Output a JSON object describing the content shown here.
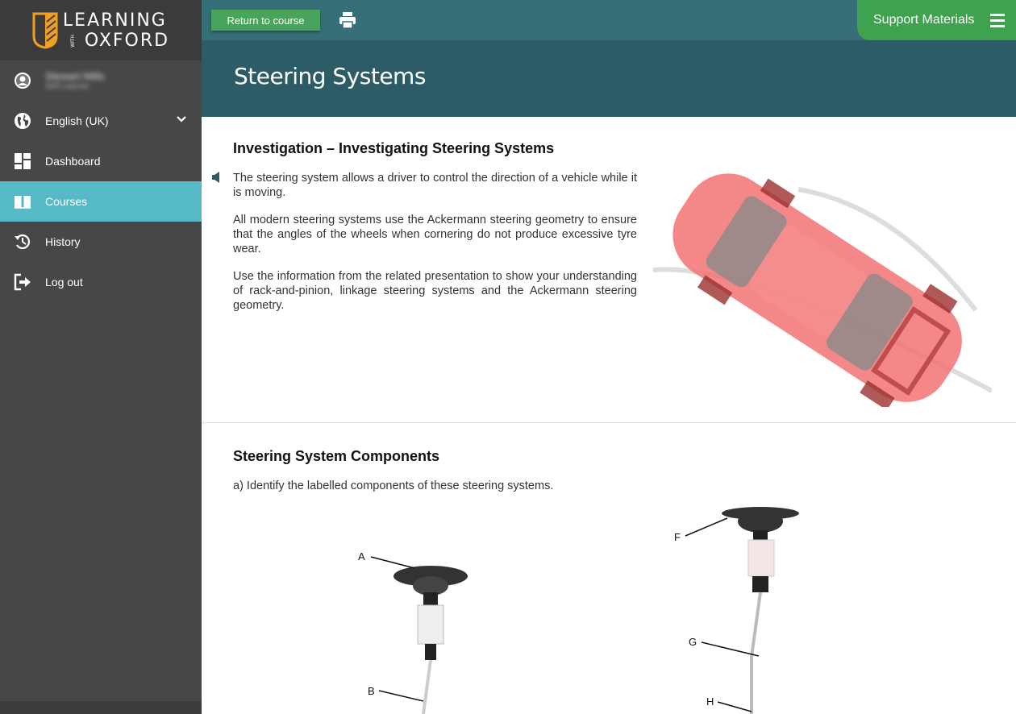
{
  "sidebar": {
    "logo": {
      "line1": "LEARNING",
      "with": "WITH",
      "line2": "OXFORD",
      "accent": "#f0a020"
    },
    "user": {
      "name": "Stewart Mills",
      "role": "Self Learner",
      "icon": "user-circle-icon"
    },
    "language": {
      "label": "English (UK)",
      "icon": "globe-icon"
    },
    "items": [
      {
        "label": "Dashboard",
        "icon": "dashboard-icon"
      },
      {
        "label": "Courses",
        "icon": "book-icon",
        "active": true
      },
      {
        "label": "History",
        "icon": "history-icon"
      },
      {
        "label": "Log out",
        "icon": "logout-icon"
      }
    ],
    "active_color": "#56b9c6"
  },
  "topbar": {
    "return_label": "Return to course",
    "print_icon": "print-icon",
    "support_label": "Support Materials",
    "menu_icon": "hamburger-icon"
  },
  "header": {
    "title": "Steering Systems"
  },
  "section1": {
    "heading": "Investigation – Investigating Steering Systems",
    "paragraphs": [
      "The steering system allows a driver to control the direction of a vehicle while it is moving.",
      "All modern steering systems use the Ackermann steering geometry to ensure that the angles of the wheels when cornering do not produce excessive tyre wear.",
      "Use the information from the related presentation to show your understanding of rack-and-pinion, linkage steering systems and the Ackermann steering geometry."
    ],
    "image": "car-steering-illustration"
  },
  "section2": {
    "heading": "Steering System Components",
    "instruction": "a) Identify the labelled components of these steering systems.",
    "diagram1_labels": [
      "A",
      "B"
    ],
    "diagram2_labels": [
      "F",
      "G",
      "H"
    ]
  }
}
